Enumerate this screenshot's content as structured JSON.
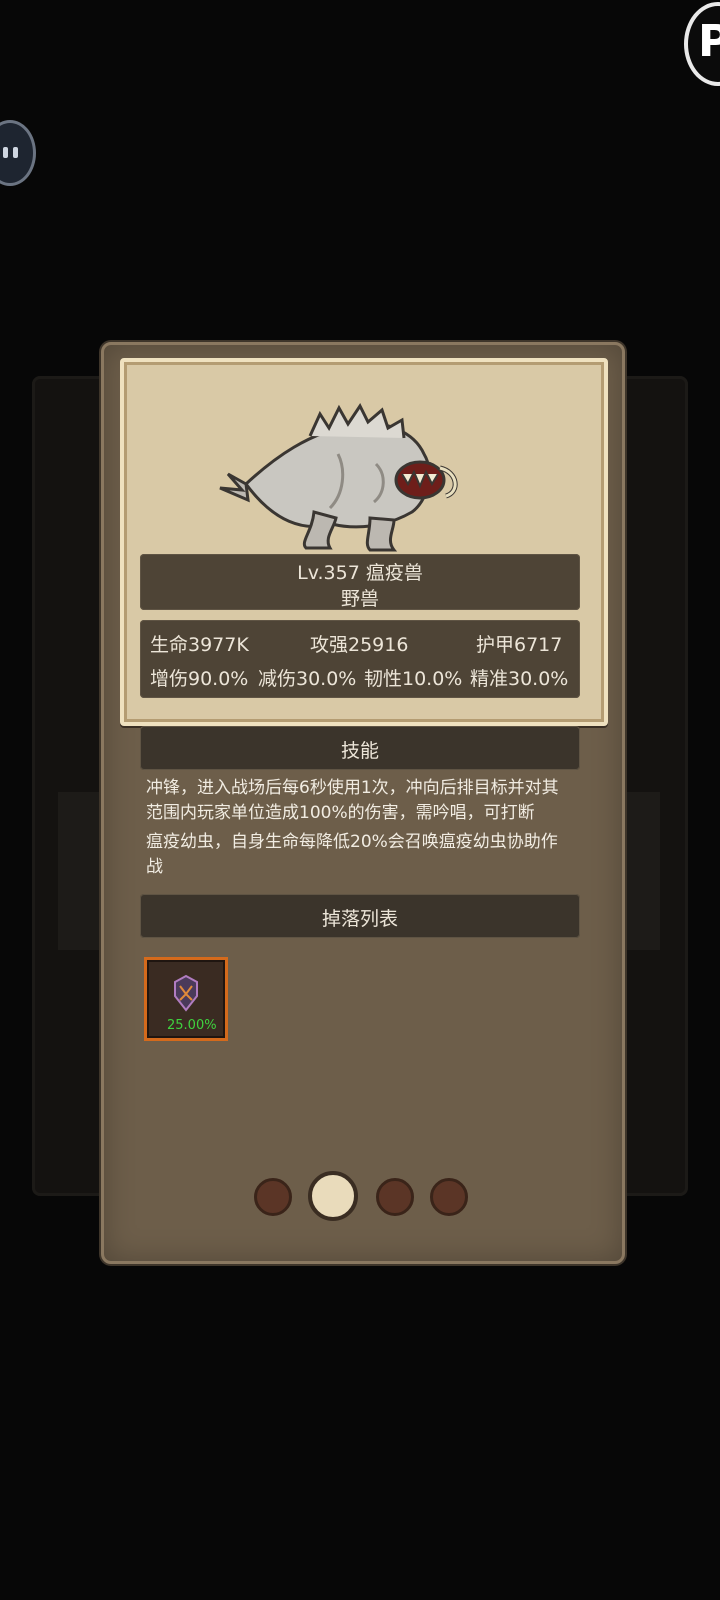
{
  "monster": {
    "title": "Lv.357 瘟疫兽",
    "category": "野兽"
  },
  "stats": {
    "row1": [
      "生命3977K",
      "攻强25916",
      "护甲6717"
    ],
    "row2": [
      "增伤90.0%",
      "减伤30.0%",
      "韧性10.0%",
      "精准30.0%"
    ]
  },
  "skill": {
    "header": "技能",
    "lines": [
      "冲锋，进入战场后每6秒使用1次，冲向后排目标并对其",
      "范围内玩家单位造成100%的伤害，需吟唱，可打断",
      "瘟疫幼虫，自身生命每降低20%会召唤瘟疫幼虫协助作",
      "战"
    ]
  },
  "drops": {
    "header": "掉落列表",
    "items": [
      {
        "icon": "armor-piece-icon",
        "chance": "25.00%"
      }
    ]
  },
  "pager": {
    "count": 4,
    "active": 2
  },
  "corner_badge": "P",
  "colors": {
    "panel": "#6d5e4a",
    "card": "#d9c9a6",
    "drop_frame": "#d46a1c",
    "drop_chance": "#3fd23f"
  }
}
